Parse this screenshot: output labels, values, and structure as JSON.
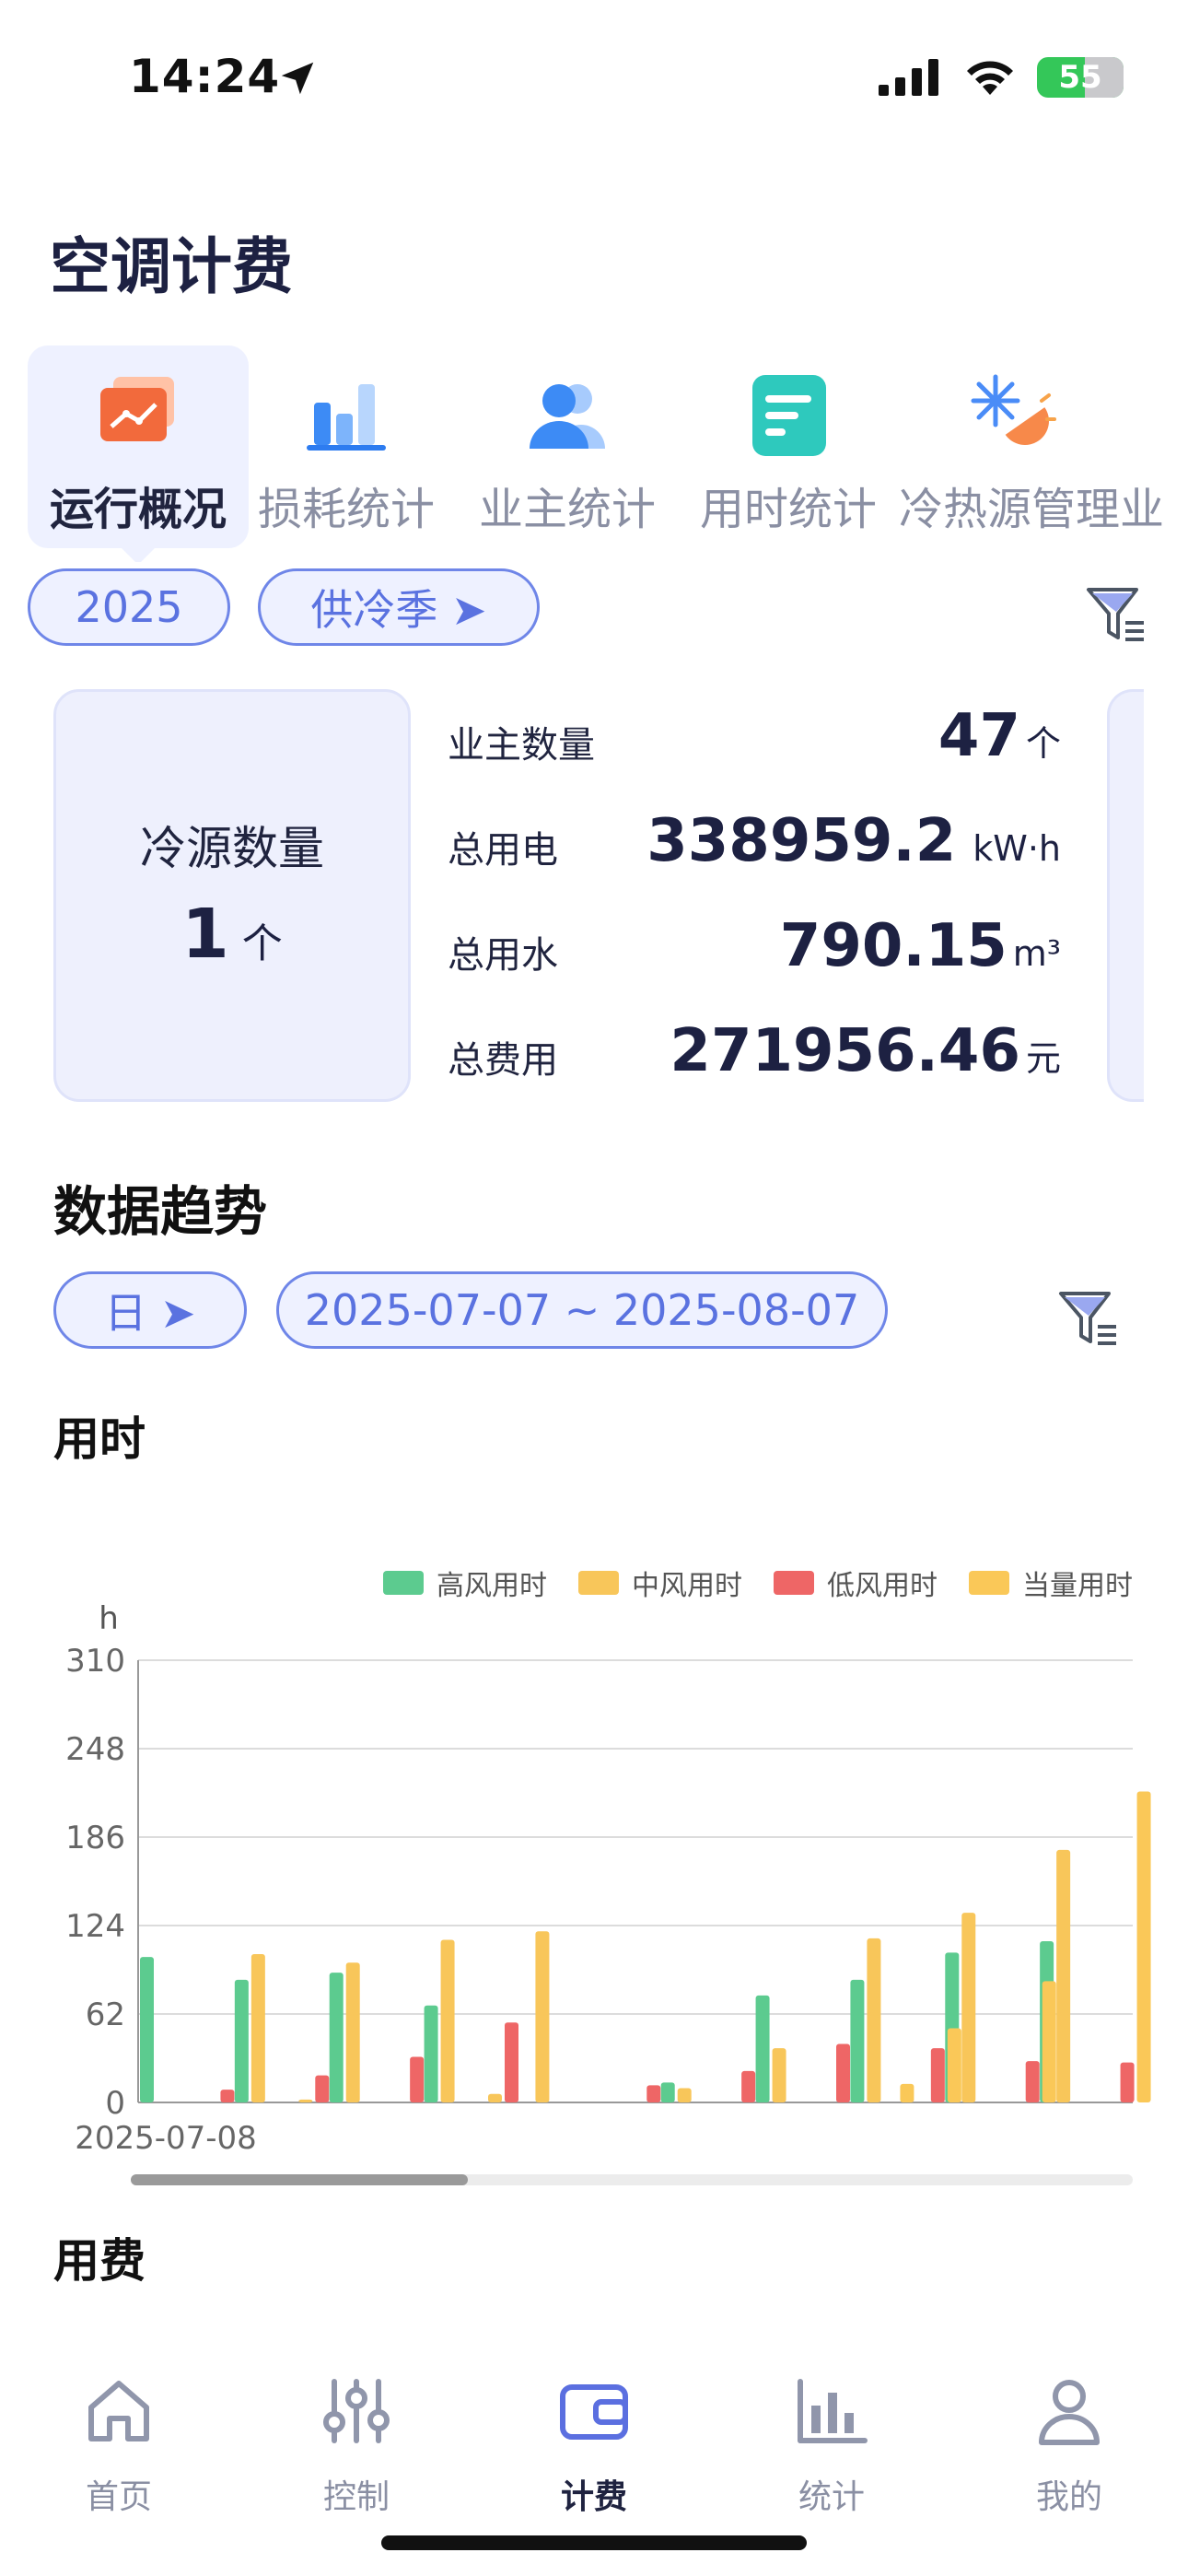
{
  "status_bar": {
    "time": "14:24",
    "battery": "55"
  },
  "page_title": "空调计费",
  "tabs": [
    {
      "label": "运行概况",
      "icon": "chart-line-icon",
      "active": true
    },
    {
      "label": "损耗统计",
      "icon": "bar-chart-icon",
      "active": false
    },
    {
      "label": "业主统计",
      "icon": "users-icon",
      "active": false
    },
    {
      "label": "用时统计",
      "icon": "document-lines-icon",
      "active": false
    },
    {
      "label": "冷热源管理",
      "icon": "snow-sun-icon",
      "active": false
    },
    {
      "label": "业",
      "icon": "",
      "active": false
    }
  ],
  "filters": {
    "year": "2025",
    "season": "供冷季 ➤"
  },
  "overview": {
    "cold_source": {
      "label": "冷源数量",
      "value": "1",
      "unit": "个"
    },
    "stats": [
      {
        "label": "业主数量",
        "value": "47",
        "unit": "个",
        "bg": "#e8f3ff",
        "border": "#d3e6fb"
      },
      {
        "label": "总用电",
        "value": "338959.2",
        "unit": "kW·h",
        "bg": "#fdeee6",
        "border": "#f8dccc"
      },
      {
        "label": "总用水",
        "value": "790.15",
        "unit": "m³",
        "bg": "#eceffd",
        "border": "#dde1f8"
      },
      {
        "label": "总费用",
        "value": "271956.46",
        "unit": "元",
        "bg": "#e4f7f5",
        "border": "#cdeee9"
      }
    ]
  },
  "trend": {
    "title": "数据趋势",
    "period": "日 ➤",
    "range": "2025-07-07 ~ 2025-08-07",
    "usage_title": "用时",
    "cost_title": "用费"
  },
  "chart_data": {
    "type": "bar",
    "ylabel": "h",
    "ylim": [
      0,
      310
    ],
    "yticks": [
      0,
      62,
      124,
      186,
      248,
      310
    ],
    "grid": true,
    "legend_position": "top-right",
    "visible_x_label": "2025-07-08",
    "series": [
      {
        "name": "高风用时",
        "color": "#5ccb8f",
        "values": [
          102,
          0,
          86,
          0,
          91,
          0,
          68,
          0,
          0,
          0,
          0,
          14,
          0,
          75,
          0,
          86,
          0,
          105,
          0,
          113,
          0
        ]
      },
      {
        "name": "中风用时",
        "color": "#f8c65a",
        "values": [
          0,
          0,
          104,
          2,
          98,
          0,
          114,
          6,
          120,
          0,
          0,
          10,
          0,
          38,
          0,
          115,
          0,
          133,
          0,
          177,
          0
        ]
      },
      {
        "name": "低风用时",
        "color": "#ee6666",
        "values": [
          0,
          9,
          0,
          19,
          0,
          32,
          0,
          56,
          0,
          0,
          12,
          0,
          22,
          0,
          41,
          0,
          38,
          0,
          29,
          0,
          28
        ]
      },
      {
        "name": "当量用时",
        "color": "#fac858",
        "values": [
          0,
          0,
          0,
          0,
          0,
          0,
          0,
          0,
          0,
          0,
          0,
          0,
          0,
          0,
          0,
          13,
          52,
          0,
          85,
          0,
          218
        ]
      }
    ]
  },
  "bottom_nav": [
    {
      "label": "首页",
      "icon": "home-icon",
      "active": false
    },
    {
      "label": "控制",
      "icon": "sliders-icon",
      "active": false
    },
    {
      "label": "计费",
      "icon": "wallet-icon",
      "active": true
    },
    {
      "label": "统计",
      "icon": "stats-icon",
      "active": false
    },
    {
      "label": "我的",
      "icon": "person-icon",
      "active": false
    }
  ]
}
